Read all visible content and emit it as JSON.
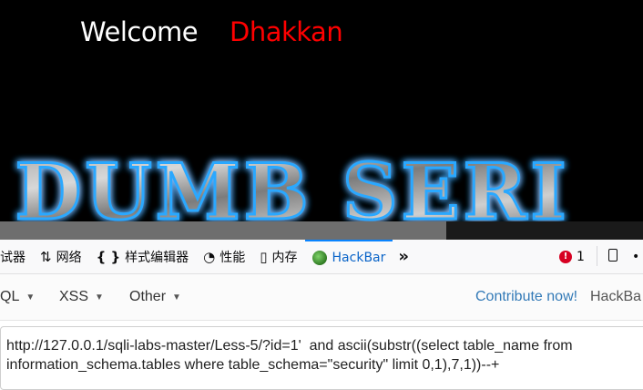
{
  "page": {
    "welcome_label": "Welcome",
    "user_name": "Dhakkan",
    "banner_text": "I DUMB SERI"
  },
  "devtools": {
    "tabs": [
      {
        "icon": "inspector-icon",
        "label": "试器"
      },
      {
        "icon": "network-icon",
        "label": "网络"
      },
      {
        "icon": "style-editor-icon",
        "label": "样式编辑器"
      },
      {
        "icon": "performance-icon",
        "label": "性能"
      },
      {
        "icon": "memory-icon",
        "label": "内存"
      },
      {
        "icon": "hackbar-icon",
        "label": "HackBar",
        "active": true
      }
    ],
    "more_tabs_icon": "chevron-double-right-icon",
    "error_count": "1",
    "accent": "#0a84ff"
  },
  "hackbar": {
    "menu": [
      "QL",
      "XSS",
      "Other"
    ],
    "contribute_label": "Contribute now!",
    "brand_label": "HackBa",
    "url_line1": "http://127.0.0.1/sqli-labs-master/Less-5/?id=1'  and ascii(substr((select table_name from",
    "url_line2": "information_schema.tables where table_schema=\"security\" limit 0,1),7,1))--+"
  },
  "colors": {
    "page_bg": "#000000",
    "welcome": "#ffffff",
    "user": "#ff0000",
    "link": "#337ab7"
  }
}
